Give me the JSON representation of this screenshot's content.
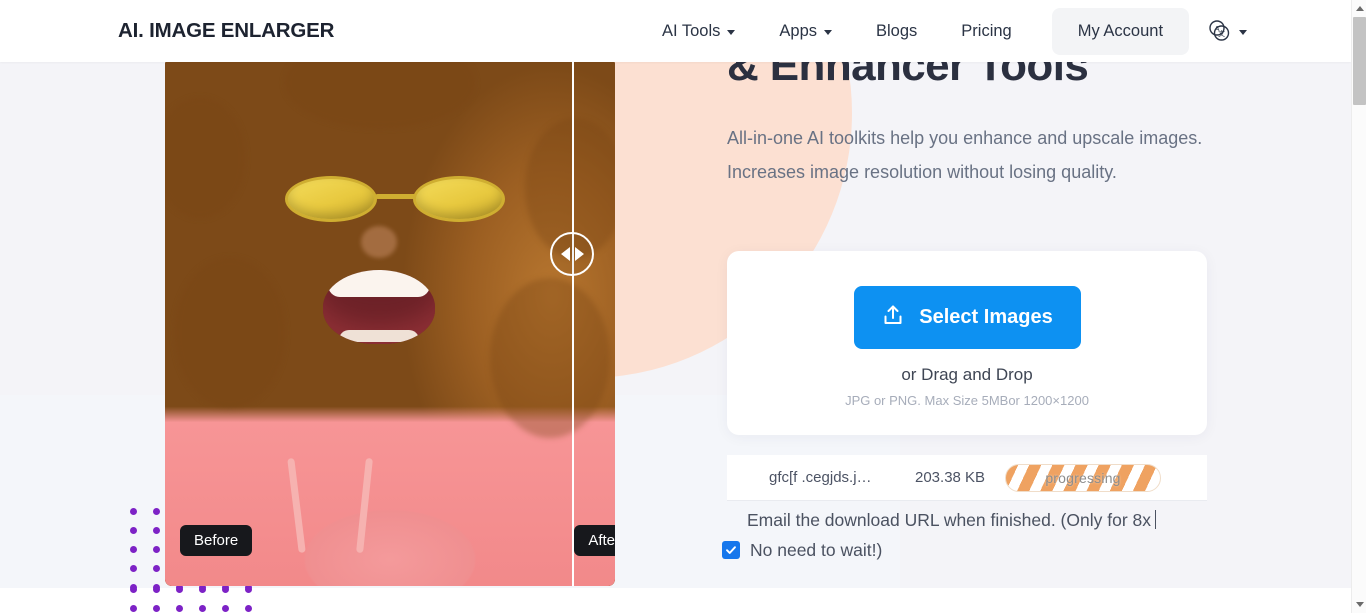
{
  "header": {
    "logo": "AI. IMAGE ENLARGER",
    "nav": [
      {
        "label": "AI Tools",
        "has_caret": true
      },
      {
        "label": "Apps",
        "has_caret": true
      },
      {
        "label": "Blogs",
        "has_caret": false
      },
      {
        "label": "Pricing",
        "has_caret": false
      }
    ],
    "account_button": "My Account",
    "language_icon": "translate-language-icon"
  },
  "hero": {
    "headline": "& Enhancer Tools",
    "subtext": "All-in-one AI toolkits help you enhance and upscale images. Increases image resolution without losing quality."
  },
  "compare": {
    "before_label": "Before",
    "after_label": "After",
    "handle_icon": "left-right-arrows-icon"
  },
  "upload": {
    "button_label": "Select Images",
    "button_icon": "upload-icon",
    "drag_text": "or Drag and Drop",
    "limit_text": "JPG or PNG. Max Size 5MBor 1200×1200",
    "accent_color": "#0d91f2"
  },
  "file_row": {
    "name": "gfc[f .cegjds.j…",
    "size": "203.38 KB",
    "status": "progressing",
    "status_color": "#efa261"
  },
  "email_option": {
    "line1": "Email the download URL when finished. (Only for 8x",
    "line2": "No need to wait!)",
    "checked": true,
    "checkbox_color": "#1677ec"
  },
  "scrollbar": {
    "up_icon": "scroll-up-arrow-icon",
    "down_icon": "scroll-down-arrow-icon"
  }
}
